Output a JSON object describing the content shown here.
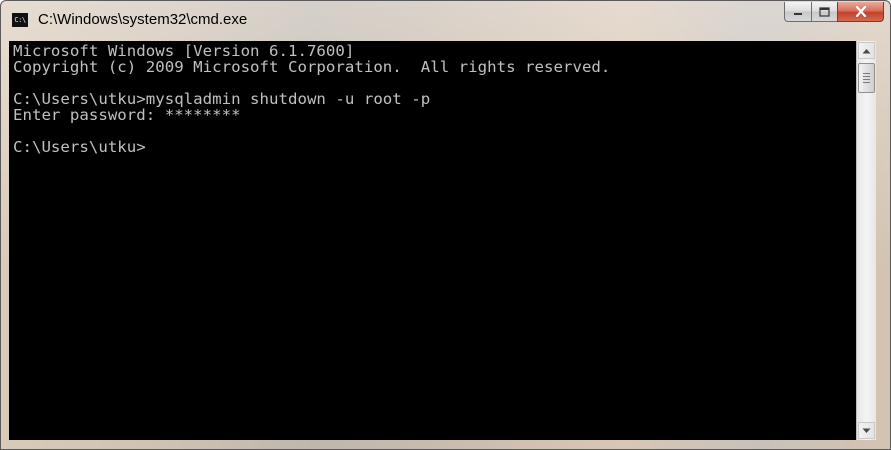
{
  "window": {
    "title": "C:\\Windows\\system32\\cmd.exe",
    "icon": "cmd-icon",
    "icon_text": "C:\\",
    "buttons": {
      "minimize": "minimize-icon",
      "maximize": "maximize-icon",
      "close": "close-icon"
    }
  },
  "console": {
    "lines": [
      "Microsoft Windows [Version 6.1.7600]",
      "Copyright (c) 2009 Microsoft Corporation.  All rights reserved.",
      "",
      "C:\\Users\\utku>mysqladmin shutdown -u root -p",
      "Enter password: ********",
      "",
      "C:\\Users\\utku>"
    ],
    "colors": {
      "background": "#000000",
      "foreground": "#c0c0c0"
    }
  },
  "scrollbar": {
    "position": 0.0
  }
}
